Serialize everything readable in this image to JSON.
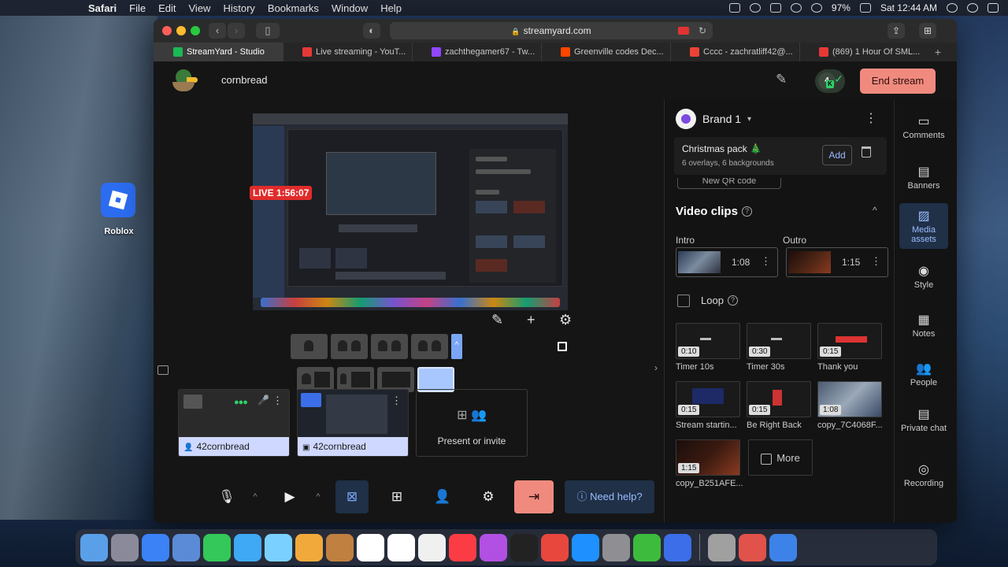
{
  "menubar": {
    "app": "Safari",
    "items": [
      "File",
      "Edit",
      "View",
      "History",
      "Bookmarks",
      "Window",
      "Help"
    ],
    "battery": "97%",
    "clock": "Sat 12:44 AM"
  },
  "desktop": {
    "icon_label": "Roblox"
  },
  "browser": {
    "url": "streamyard.com",
    "tabs": [
      {
        "label": "StreamYard - Studio",
        "color": "#1db954"
      },
      {
        "label": "Live streaming - YouT...",
        "color": "#e53935"
      },
      {
        "label": "zachthegamer67 - Tw...",
        "color": "#9146ff"
      },
      {
        "label": "Greenville codes Dec...",
        "color": "#ff4500"
      },
      {
        "label": "Cccc - zachratliff42@...",
        "color": "#ea4335"
      },
      {
        "label": "(869) 1 Hour Of SML...",
        "color": "#e53935"
      }
    ]
  },
  "header": {
    "channel": "cornbread",
    "end_stream": "End stream",
    "avatar_letter": "4",
    "avatar_badge": "K"
  },
  "stage": {
    "live_badge": "LIVE 1:56:07",
    "sources": [
      {
        "name": "42cornbread"
      },
      {
        "name": "42cornbread"
      }
    ],
    "present_label": "Present or invite"
  },
  "bottom_bar": {
    "need_help": "Need help?"
  },
  "panel": {
    "brand": "Brand 1",
    "pack_title": "Christmas pack 🎄",
    "pack_sub": "6 overlays, 6 backgrounds",
    "pack_add": "Add",
    "qr_label": "New QR code",
    "section": "Video clips",
    "intro_label": "Intro",
    "outro_label": "Outro",
    "intro_duration": "1:08",
    "outro_duration": "1:15",
    "loop_label": "Loop",
    "clips": [
      {
        "duration": "0:10",
        "label": "Timer 10s"
      },
      {
        "duration": "0:30",
        "label": "Timer 30s"
      },
      {
        "duration": "0:15",
        "label": "Thank you"
      },
      {
        "duration": "0:15",
        "label": "Stream startin..."
      },
      {
        "duration": "0:15",
        "label": "Be Right Back"
      },
      {
        "duration": "1:08",
        "label": "copy_7C4068F..."
      },
      {
        "duration": "1:15",
        "label": "copy_B251AFE..."
      }
    ],
    "more_label": "More"
  },
  "sidebar": {
    "items": [
      "Comments",
      "Banners",
      "Media assets",
      "Style",
      "Notes",
      "People",
      "Private chat",
      "Recording"
    ]
  },
  "dock_colors": [
    "#5aa0e8",
    "#8a8a9a",
    "#3b82f6",
    "#5b8bd6",
    "#34c759",
    "#3fa9f5",
    "#7ad1ff",
    "#f2a93b",
    "#c08040",
    "#ffffff",
    "#ffffff",
    "#f0f0f0",
    "#fc3c44",
    "#b150e2",
    "#222222",
    "#e8473e",
    "#1e90ff",
    "#8e8e93",
    "#3dbb3d",
    "#3b6ee8",
    "#a0a0a0",
    "#e0524a",
    "#3d82e8"
  ]
}
